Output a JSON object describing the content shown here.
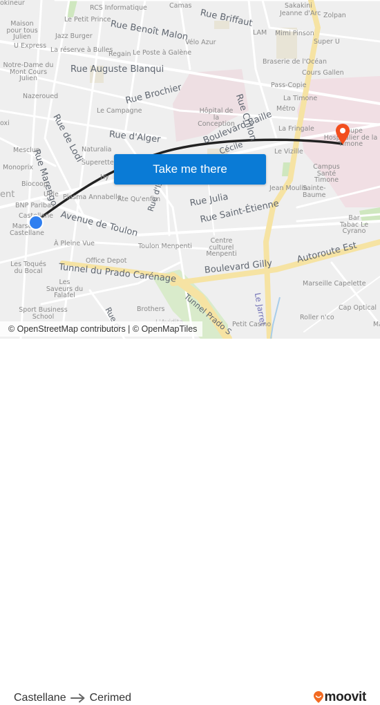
{
  "map": {
    "origin": {
      "name": "Castellane",
      "marker_color": "#2f7ff0"
    },
    "destination": {
      "name": "Cerimed",
      "marker_color": "#f24e1e"
    },
    "route_color": "#222222",
    "streets": [
      "Rue Briffaut",
      "Rue Benoît Malon",
      "Rue Auguste Blanqui",
      "Rue Brochier",
      "Rue Crillon",
      "Rue de Lodi",
      "Rue d'Alger",
      "Boulevard Baille",
      "Rue Marengo",
      "Avenue de Toulon",
      "Rue d'Isly",
      "Rue Julia",
      "Rue Saint-Étienne",
      "Tunnel du Prado Carénage",
      "Boulevard Gilly",
      "Autoroute Est",
      "Le Jarret",
      "Tunnel Prado S",
      "Rue d",
      "Cécile"
    ],
    "places": [
      "okineur",
      "RCS Informatique",
      "Camas",
      "Sakakini",
      "Jeanne d'Arc",
      "Zolpan",
      "Maison pour tous Julien",
      "Le Petit Prince",
      "Jazz Burger",
      "U Express",
      "La réserve à Bulles",
      "Regain",
      "Le Poste à Galène",
      "Vélo Azur",
      "LAM",
      "Mimi Pinson",
      "Super U",
      "Notre-Dame du Mont Cours Julien",
      "Braserie de l'Océan",
      "Cours Gallen",
      "Nazeroued",
      "Pass-Copie",
      "La Timone",
      "Hôpital de la Conception",
      "Métro",
      "Le Campagne",
      "La Fringale",
      "Groupe Hospitalier de la Timone",
      "oxi",
      "Mesclun",
      "Naturalia",
      "Superette D",
      "Le Vizille",
      "Monoprix",
      "Campus Santé Timone",
      "ent",
      "Biocoop",
      "Hy",
      "Utile",
      "Plasma Annabelle",
      "Ate Qu'enfim",
      "Jean Moulin",
      "Sainte-Baume",
      "BNP Paribas",
      "Castellane",
      "Marseille Castellane",
      "Bar Tabac Le Cyrano",
      "À Pleine Vue",
      "Toulon Menpenti",
      "Centre culturel Menpenti",
      "Office Depot",
      "Les Toqués du Bocal",
      "Les Saveurs du Falafel",
      "Marseille Capelette",
      "Cap Optical",
      "Sport Business School",
      "Brothers",
      "L'Avidita",
      "Roller n'co",
      "Petit Casino",
      "Ma"
    ]
  },
  "cta": {
    "label": "Take me there"
  },
  "attribution": "© OpenStreetMap contributors | © OpenMapTiles",
  "footer": {
    "from": "Castellane",
    "to": "Cerimed",
    "brand": "moovit",
    "brand_color": "#f26a21"
  }
}
